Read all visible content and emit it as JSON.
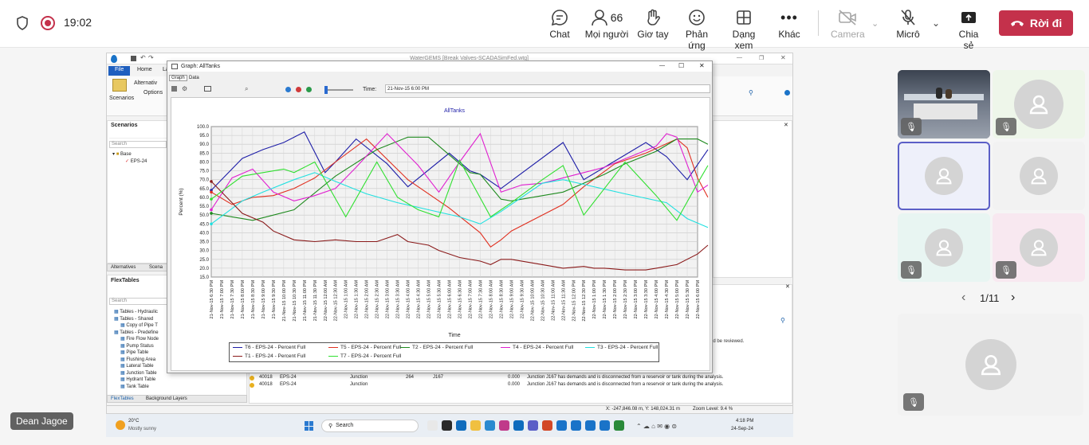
{
  "meeting": {
    "time": "19:02",
    "actions": {
      "chat": "Chat",
      "people": "Mọi người",
      "people_count": "66",
      "raise": "Giơ tay",
      "react": "Phản ứng",
      "view": "Dạng xem",
      "more": "Khác",
      "camera": "Camera",
      "mic": "Micrô",
      "share": "Chia sẻ",
      "leave": "Rời đi"
    },
    "presenter": "Dean Jagoe",
    "pagination": "1/11"
  },
  "app": {
    "title": "WaterGEMS [Break Valves-SCADASimFed.wtg]",
    "tabs": [
      "File",
      "Home",
      "La"
    ],
    "ribbon": {
      "scenarios": "Scenarios",
      "alternatives": "Alternativ",
      "options": "Options"
    },
    "scenarios_panel": {
      "title": "Scenarios",
      "search": "Search",
      "base": "Base",
      "eps": "EPS-24"
    },
    "lower_tabs": [
      "Alternatives",
      "Scena"
    ],
    "flextables": {
      "title": "FlexTables",
      "search": "Search",
      "items": [
        "Tables - Hydraulic",
        "Tables - Shared",
        "Copy of Pipe T",
        "Tables - Predefine",
        "Fire Flow Node",
        "Pump Status",
        "Pipe Table",
        "Flushing Area",
        "Lateral Table",
        "Junction Table",
        "Hydrant Table",
        "Tank Table"
      ],
      "bottom_tabs": [
        "FlexTables",
        "Background Layers"
      ]
    },
    "messages": {
      "partial": "ld be reviewed.",
      "rows": [
        {
          "id": "40018",
          "scenario": "EPS-24",
          "type": "Junction",
          "n": "264",
          "label": "J167",
          "val": "0.000",
          "msg": "Junction J167 has demands and is disconnected from a reservoir or tank during the analysis."
        },
        {
          "id": "40018",
          "scenario": "EPS-24",
          "type": "Junction",
          "n": "",
          "label": "",
          "val": "0.000",
          "msg": "Junction J167 has demands and is disconnected from a reservoir or tank during the analysis."
        }
      ]
    },
    "status_bar": {
      "coords": "X: -247,846.08 m, Y: 148,024.31 m",
      "zoom": "Zoom Level: 9.4 %"
    }
  },
  "graph": {
    "window_title": "Graph: AllTanks",
    "tabs": [
      "Graph",
      "Data"
    ],
    "time_label": "Time:",
    "time_value": "21-Nov-15 6:00 PM"
  },
  "chart_data": {
    "type": "line",
    "title": "AllTanks",
    "xlabel": "Time",
    "ylabel": "Percent (%)",
    "ylim": [
      15.0,
      100.0
    ],
    "yticks": [
      "100.0",
      "95.0",
      "90.0",
      "85.0",
      "80.0",
      "75.0",
      "70.0",
      "65.0",
      "60.0",
      "55.0",
      "50.0",
      "45.0",
      "40.0",
      "35.0",
      "30.0",
      "25.0",
      "20.0",
      "15.0"
    ],
    "x": [
      "21-Nov-15 6:30 PM",
      "21-Nov-15 7:00 PM",
      "21-Nov-15 7:30 PM",
      "21-Nov-15 8:00 PM",
      "21-Nov-15 8:30 PM",
      "21-Nov-15 9:00 PM",
      "21-Nov-15 9:30 PM",
      "21-Nov-15 10:00 PM",
      "21-Nov-15 10:30 PM",
      "21-Nov-15 11:00 PM",
      "21-Nov-15 11:30 PM",
      "22-Nov-15 12:00 AM",
      "22-Nov-15 12:30 AM",
      "22-Nov-15 1:00 AM",
      "22-Nov-15 1:30 AM",
      "22-Nov-15 2:00 AM",
      "22-Nov-15 2:30 AM",
      "22-Nov-15 3:00 AM",
      "22-Nov-15 3:30 AM",
      "22-Nov-15 4:00 AM",
      "22-Nov-15 4:30 AM",
      "22-Nov-15 5:00 AM",
      "22-Nov-15 5:30 AM",
      "22-Nov-15 6:00 AM",
      "22-Nov-15 6:30 AM",
      "22-Nov-15 7:00 AM",
      "22-Nov-15 7:30 AM",
      "22-Nov-15 8:00 AM",
      "22-Nov-15 8:30 AM",
      "22-Nov-15 9:00 AM",
      "22-Nov-15 9:30 AM",
      "22-Nov-15 10:00 AM",
      "22-Nov-15 10:30 AM",
      "22-Nov-15 11:00 AM",
      "22-Nov-15 11:30 AM",
      "22-Nov-15 12:00 PM",
      "22-Nov-15 12:30 PM",
      "22-Nov-15 1:00 PM",
      "22-Nov-15 1:30 PM",
      "22-Nov-15 2:00 PM",
      "22-Nov-15 2:30 PM",
      "22-Nov-15 3:00 PM",
      "22-Nov-15 3:30 PM",
      "22-Nov-15 4:00 PM",
      "22-Nov-15 4:30 PM",
      "22-Nov-15 5:00 PM",
      "22-Nov-15 5:30 PM",
      "22-Nov-15 6:00 PM"
    ],
    "series": [
      {
        "name": "T6 - EPS-24 - Percent Full",
        "color": "#1f1fa8",
        "points": [
          [
            0,
            64
          ],
          [
            3,
            82
          ],
          [
            5,
            87
          ],
          [
            7,
            91
          ],
          [
            9,
            97
          ],
          [
            11,
            74
          ],
          [
            12,
            80
          ],
          [
            14,
            93
          ],
          [
            17,
            79
          ],
          [
            19,
            66
          ],
          [
            23,
            85
          ],
          [
            25,
            75
          ],
          [
            26,
            73
          ],
          [
            28,
            65
          ],
          [
            34,
            91
          ],
          [
            36,
            70
          ],
          [
            38,
            77
          ],
          [
            42,
            91
          ],
          [
            44,
            83
          ],
          [
            46,
            70
          ],
          [
            48,
            87
          ]
        ]
      },
      {
        "name": "T5 - EPS-24 - Percent Full",
        "color": "#e03020",
        "points": [
          [
            0,
            63
          ],
          [
            2,
            56
          ],
          [
            4,
            60
          ],
          [
            6,
            61
          ],
          [
            8,
            65
          ],
          [
            10,
            71
          ],
          [
            12,
            80
          ],
          [
            15,
            93
          ],
          [
            19,
            70
          ],
          [
            23,
            54
          ],
          [
            26,
            40
          ],
          [
            27,
            32
          ],
          [
            28,
            36
          ],
          [
            29,
            41
          ],
          [
            34,
            56
          ],
          [
            36,
            66
          ],
          [
            39,
            79
          ],
          [
            42,
            85
          ],
          [
            45,
            93
          ],
          [
            46,
            88
          ],
          [
            47,
            71
          ],
          [
            48,
            60
          ]
        ]
      },
      {
        "name": "T2 - EPS-24 - Percent Full",
        "color": "#1f8a1f",
        "points": [
          [
            0,
            51
          ],
          [
            2,
            49
          ],
          [
            3,
            48
          ],
          [
            4,
            47
          ],
          [
            6,
            50
          ],
          [
            8,
            53
          ],
          [
            12,
            72
          ],
          [
            16,
            87
          ],
          [
            19,
            94
          ],
          [
            21,
            94
          ],
          [
            25,
            74
          ],
          [
            26,
            73
          ],
          [
            28,
            59
          ],
          [
            29,
            58
          ],
          [
            34,
            63
          ],
          [
            38,
            73
          ],
          [
            40,
            79
          ],
          [
            43,
            86
          ],
          [
            45,
            93
          ],
          [
            47,
            93
          ],
          [
            48,
            90
          ]
        ]
      },
      {
        "name": "T4 - EPS-24 - Percent Full",
        "color": "#e020d0",
        "points": [
          [
            0,
            53
          ],
          [
            2,
            71
          ],
          [
            4,
            76
          ],
          [
            6,
            63
          ],
          [
            8,
            58
          ],
          [
            10,
            61
          ],
          [
            12,
            65
          ],
          [
            14,
            77
          ],
          [
            17,
            96
          ],
          [
            20,
            78
          ],
          [
            22,
            63
          ],
          [
            24,
            80
          ],
          [
            26,
            96
          ],
          [
            28,
            63
          ],
          [
            30,
            67
          ],
          [
            32,
            68
          ],
          [
            36,
            74
          ],
          [
            38,
            77
          ],
          [
            43,
            89
          ],
          [
            44,
            96
          ],
          [
            45,
            94
          ],
          [
            47,
            63
          ],
          [
            48,
            67
          ]
        ]
      },
      {
        "name": "T3 - EPS-24 - Percent Full",
        "color": "#20e0e0",
        "points": [
          [
            0,
            45
          ],
          [
            3,
            58
          ],
          [
            5,
            63
          ],
          [
            8,
            70
          ],
          [
            10,
            74
          ],
          [
            12,
            69
          ],
          [
            15,
            62
          ],
          [
            18,
            57
          ],
          [
            21,
            53
          ],
          [
            24,
            49
          ],
          [
            26,
            45
          ],
          [
            28,
            52
          ],
          [
            32,
            68
          ],
          [
            34,
            70
          ],
          [
            37,
            66
          ],
          [
            40,
            62
          ],
          [
            44,
            57
          ],
          [
            46,
            48
          ],
          [
            48,
            43
          ]
        ]
      },
      {
        "name": "T1 - EPS-24 - Percent Full",
        "color": "#8a1a1a",
        "points": [
          [
            0,
            69
          ],
          [
            2,
            57
          ],
          [
            3,
            51
          ],
          [
            5,
            46
          ],
          [
            6,
            41
          ],
          [
            8,
            36
          ],
          [
            10,
            35
          ],
          [
            12,
            36
          ],
          [
            14,
            35
          ],
          [
            16,
            35
          ],
          [
            18,
            39
          ],
          [
            19,
            35
          ],
          [
            21,
            33
          ],
          [
            22,
            30
          ],
          [
            24,
            26
          ],
          [
            26,
            24
          ],
          [
            27,
            22
          ],
          [
            28,
            25
          ],
          [
            29,
            25
          ],
          [
            32,
            22
          ],
          [
            34,
            20
          ],
          [
            36,
            21
          ],
          [
            37,
            20
          ],
          [
            38,
            20
          ],
          [
            40,
            19
          ],
          [
            42,
            19
          ],
          [
            43,
            20
          ],
          [
            45,
            22
          ],
          [
            47,
            28
          ],
          [
            48,
            33
          ]
        ]
      },
      {
        "name": "T7 - EPS-24 - Percent Full",
        "color": "#30e030",
        "points": [
          [
            0,
            59
          ],
          [
            3,
            72
          ],
          [
            5,
            74
          ],
          [
            7,
            76
          ],
          [
            8,
            74
          ],
          [
            10,
            80
          ],
          [
            13,
            49
          ],
          [
            16,
            80
          ],
          [
            18,
            60
          ],
          [
            20,
            53
          ],
          [
            22,
            49
          ],
          [
            24,
            81
          ],
          [
            27,
            49
          ],
          [
            29,
            57
          ],
          [
            32,
            70
          ],
          [
            34,
            78
          ],
          [
            36,
            50
          ],
          [
            40,
            80
          ],
          [
            43,
            61
          ],
          [
            45,
            47
          ],
          [
            47,
            68
          ],
          [
            48,
            78
          ]
        ]
      }
    ]
  },
  "taskbar": {
    "weather_temp": "20°C",
    "weather_desc": "Mostly sunny",
    "search": "Search",
    "time": "4:18 PM",
    "date": "24-Sep-24"
  }
}
